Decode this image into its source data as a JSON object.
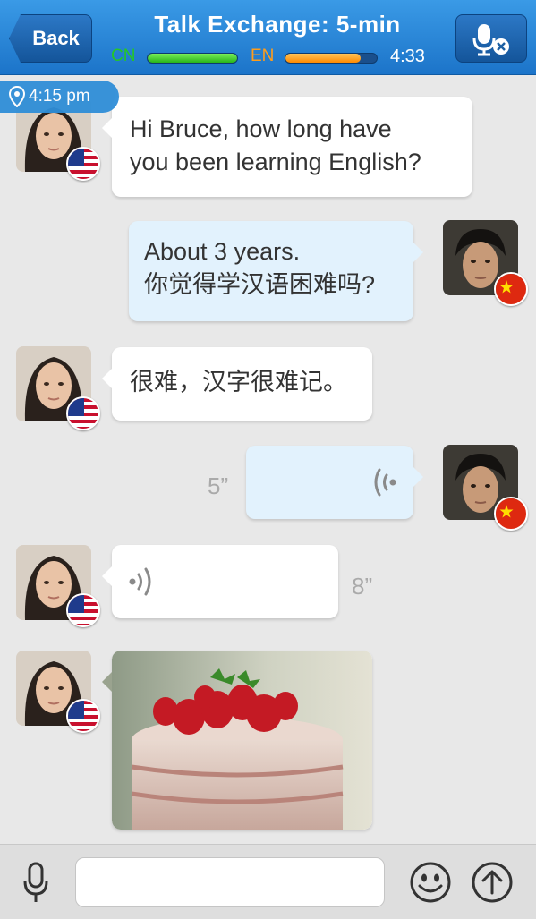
{
  "header": {
    "back_label": "Back",
    "title": "Talk Exchange: 5-min",
    "cn_label": "CN",
    "en_label": "EN",
    "cn_progress": 1.0,
    "en_progress": 0.82,
    "timer": "4:33",
    "mic_mute_icon": "microphone-cancel-icon"
  },
  "location": {
    "icon": "location-pin-icon",
    "time": "4:15 pm"
  },
  "messages": [
    {
      "side": "left",
      "sender_flag": "us",
      "line1": "Hi Bruce, how long have",
      "line2": "you been learning English?"
    },
    {
      "side": "right",
      "sender_flag": "cn",
      "line1": "About 3 years.",
      "line2": "你觉得学汉语困难吗?"
    },
    {
      "side": "left",
      "sender_flag": "us",
      "line1": "很难，汉字很难记。"
    },
    {
      "side": "right",
      "sender_flag": "cn",
      "type": "voice",
      "duration": "5”"
    },
    {
      "side": "left",
      "sender_flag": "us",
      "type": "voice",
      "duration": "8”"
    },
    {
      "side": "left",
      "sender_flag": "us",
      "type": "image",
      "image_subject": "strawberry cake"
    }
  ],
  "bottom_bar": {
    "mic_icon": "microphone-icon",
    "input_value": "",
    "input_placeholder": "",
    "emoji_icon": "smiley-icon",
    "send_icon": "arrow-up-circle-icon"
  },
  "colors": {
    "header_blue": "#2a86d8",
    "cn_green": "#25c626",
    "en_orange": "#ff9d1a",
    "bubble_right": "#e2f2fd",
    "bubble_left": "#ffffff"
  }
}
